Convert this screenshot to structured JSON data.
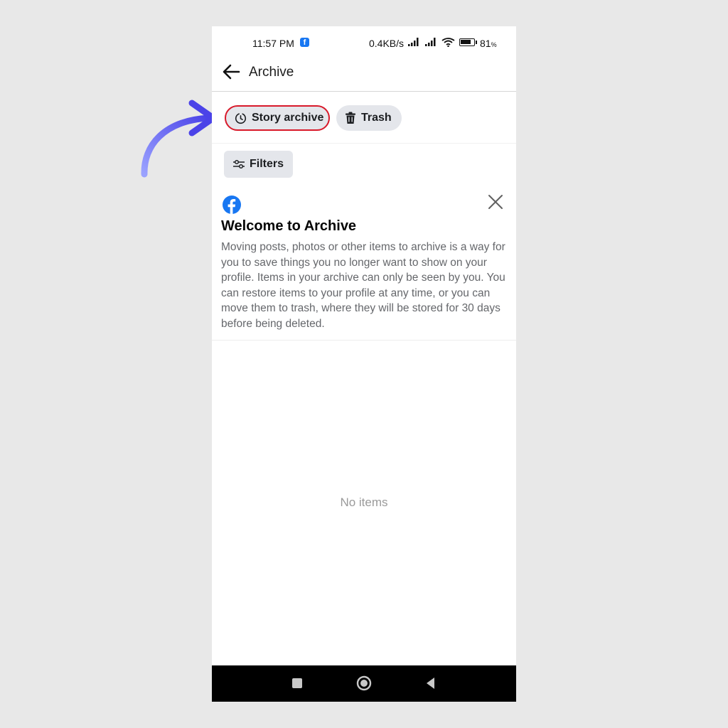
{
  "status_bar": {
    "time": "11:57 PM",
    "fb_badge": "f",
    "net_speed": "0.4KB/s",
    "battery_percent": "81",
    "battery_sign": "%",
    "battery_level": 0.81
  },
  "header": {
    "title": "Archive"
  },
  "tabs": [
    {
      "label": "Story archive",
      "icon": "clock-icon",
      "highlighted": true
    },
    {
      "label": "Trash",
      "icon": "trash-icon"
    }
  ],
  "filters": {
    "label": "Filters",
    "icon": "sliders-icon"
  },
  "welcome": {
    "title": "Welcome to Archive",
    "body": "Moving posts, photos or other items to archive is a way for you to save things you no longer want to show on your profile. Items in your archive can only be seen by you. You can restore items to your profile at any time, or you can move them to trash, where they will be stored for 30 days before being deleted."
  },
  "empty_state": {
    "text": "No items"
  },
  "colors": {
    "highlight_border": "#d8192a",
    "brand": "#1877f2",
    "annotation_arrow": "#5b5bf0"
  }
}
